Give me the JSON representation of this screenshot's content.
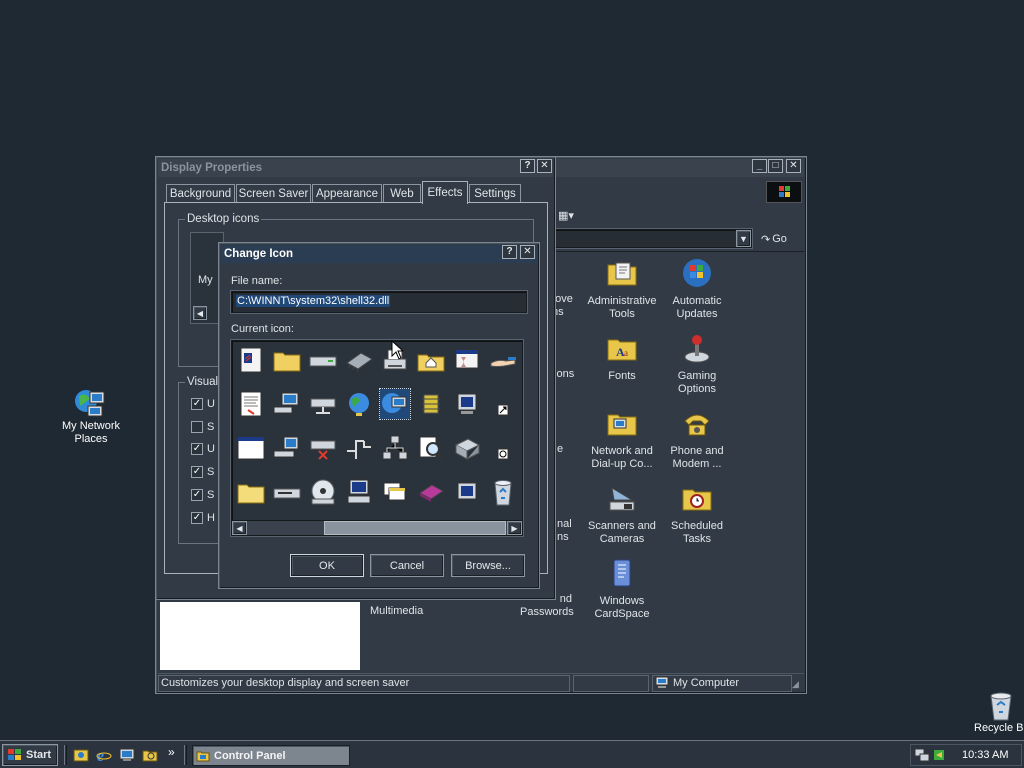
{
  "desktop": {
    "icons": [
      {
        "name": "network-places",
        "label_line1": "My Network",
        "label_line2": "Places",
        "icon": "network-places-icon"
      },
      {
        "name": "recycle-bin",
        "label": "Recycle Bin",
        "icon": "recycle-bin-icon"
      }
    ]
  },
  "control_panel": {
    "toolbar_go": "Go",
    "items": [
      {
        "line1": "Administrative",
        "line2": "Tools",
        "icon": "admin-tools-icon"
      },
      {
        "line1": "Automatic",
        "line2": "Updates",
        "icon": "windows-update-icon"
      },
      {
        "line1": "Fonts",
        "line2": "",
        "icon": "fonts-folder-icon"
      },
      {
        "line1": "Gaming",
        "line2": "Options",
        "icon": "joystick-icon"
      },
      {
        "line1": "Network and",
        "line2": "Dial-up Co...",
        "icon": "network-dialup-icon"
      },
      {
        "line1": "Phone and",
        "line2": "Modem ...",
        "icon": "phone-modem-icon"
      },
      {
        "line1": "Scanners and",
        "line2": "Cameras",
        "icon": "scanner-icon"
      },
      {
        "line1": "Scheduled",
        "line2": "Tasks",
        "icon": "scheduled-tasks-icon"
      },
      {
        "line1": "Windows",
        "line2": "CardSpace",
        "icon": "cardspace-icon"
      }
    ],
    "partial_labels": {
      "remove_line1": "nove",
      "remove_line2": "ms",
      "options": "tions",
      "regional_line1": "nal",
      "regional_line2": "ns",
      "passwords_line1": "nd",
      "passwords_line2": "Passwords",
      "multimedia": "Multimedia",
      "e_fragment": "e"
    },
    "status_left": "Customizes your desktop display and screen saver",
    "status_right": "My Computer"
  },
  "display_properties": {
    "title": "Display Properties",
    "tabs": [
      "Background",
      "Screen Saver",
      "Appearance",
      "Web",
      "Effects",
      "Settings"
    ],
    "active_tab": "Effects",
    "desktop_icons_label": "Desktop icons",
    "my_fragment": "My",
    "visual_label": "Visual",
    "checkbox_letters": [
      "U",
      "S",
      "U",
      "S",
      "S",
      "H"
    ],
    "checkbox_checked": [
      true,
      false,
      true,
      true,
      true,
      true
    ]
  },
  "change_icon": {
    "title": "Change Icon",
    "file_name_label": "File name:",
    "file_name_value": "C:\\WINNT\\system32\\shell32.dll",
    "current_icon_label": "Current icon:",
    "ok_label": "OK",
    "cancel_label": "Cancel",
    "browse_label": "Browse...",
    "icons": [
      [
        "application-window-icon",
        "folder-icon",
        "drive-icon",
        "memory-chip-icon",
        "printer-icon",
        "home-folder-icon",
        "hourglass-window-icon",
        "hand-share-icon"
      ],
      [
        "document-icon",
        "network-computer-icon",
        "network-drive-icon",
        "globe-icon",
        "network-globe-icon",
        "component-icon",
        "monitor-icon",
        "shortcut-arrow-icon"
      ],
      [
        "blank-window-icon",
        "computer-icon",
        "disconnected-drive-icon",
        "network-line-icon",
        "network-tree-icon",
        "search-icon",
        "drive-box-icon",
        "clock-small-icon"
      ],
      [
        "open-folder-icon",
        "floppy-drive-icon",
        "cd-rom-icon",
        "pc-icon",
        "multiple-windows-icon",
        "book-icon",
        "monitor-small-icon",
        "recycle-bin-icon"
      ]
    ]
  },
  "taskbar": {
    "start_label": "Start",
    "task_label": "Control Panel",
    "clock": "10:33 AM",
    "quicklaunch": [
      "outlook-icon",
      "internet-explorer-icon",
      "show-desktop-icon",
      "explorer-icon"
    ],
    "chevron": "»"
  },
  "colors": {
    "desktop": "#1f2933",
    "window": "#323b45",
    "active_title": "#2a3d52",
    "selection": "#20497a"
  }
}
